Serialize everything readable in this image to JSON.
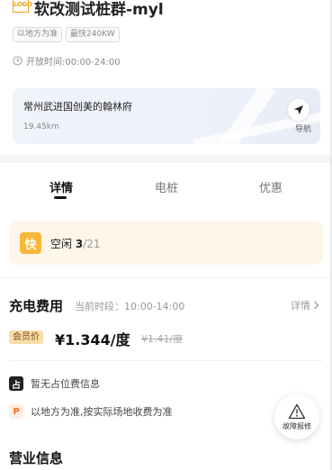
{
  "header": {
    "logo_text": "LOGO",
    "title": "软改测试桩群-myl",
    "tags": [
      "以地方为准",
      "最快240KW"
    ],
    "hours": "开放时间:00:00-24:00"
  },
  "location": {
    "address": "常州武进国创美的翰林府",
    "distance": "19.45km",
    "navigate_label": "导航"
  },
  "tabs": [
    {
      "label": "详情",
      "active": true
    },
    {
      "label": "电桩",
      "active": false
    },
    {
      "label": "优惠",
      "active": false
    }
  ],
  "availability": {
    "badge": "快",
    "label": "空闲",
    "free": "3",
    "total": "/21"
  },
  "fee": {
    "title": "充电费用",
    "period": "当前时段：10:00-14:00",
    "detail_label": "详情",
    "member_tag": "会员价",
    "member_price": "¥1.344/度",
    "original_price": "¥1.41/度"
  },
  "info": {
    "occupancy_badge": "占",
    "occupancy_text": "暂无占位费信息",
    "parking_badge": "P",
    "parking_text": "以地方为准,按实际场地收费为准"
  },
  "report": {
    "label": "故障报修"
  },
  "business": {
    "title": "营业信息"
  },
  "colors": {
    "accent": "#f9b73a",
    "member_tag_bg": "#f8dcaa",
    "parking_icon": "#f36d24"
  }
}
